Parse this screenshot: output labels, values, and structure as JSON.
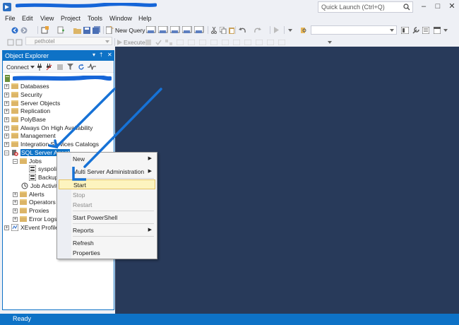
{
  "menubar": {
    "items": [
      "File",
      "Edit",
      "View",
      "Project",
      "Tools",
      "Window",
      "Help"
    ]
  },
  "quick_launch": {
    "placeholder": "Quick Launch (Ctrl+Q)"
  },
  "toolbar": {
    "new_query_label": "New Query",
    "database_value": "pethotel",
    "execute_label": "Execute"
  },
  "object_explorer": {
    "title": "Object Explorer",
    "connect_label": "Connect",
    "nodes": [
      {
        "label": "Databases"
      },
      {
        "label": "Security"
      },
      {
        "label": "Server Objects"
      },
      {
        "label": "Replication"
      },
      {
        "label": "PolyBase"
      },
      {
        "label": "Always On High Availability"
      },
      {
        "label": "Management"
      },
      {
        "label": "Integration Services Catalogs"
      },
      {
        "label": "SQL Server Agent"
      },
      {
        "label": "Jobs"
      },
      {
        "label": "syspoli"
      },
      {
        "label": "Backup"
      },
      {
        "label": "Job Activity"
      },
      {
        "label": "Alerts"
      },
      {
        "label": "Operators"
      },
      {
        "label": "Proxies"
      },
      {
        "label": "Error Logs"
      },
      {
        "label": "XEvent Profiler"
      }
    ]
  },
  "context_menu": {
    "items": [
      {
        "label": "New"
      },
      {
        "label": "Multi Server Administration"
      },
      {
        "label": "Start"
      },
      {
        "label": "Stop"
      },
      {
        "label": "Restart"
      },
      {
        "label": "Start PowerShell"
      },
      {
        "label": "Reports"
      },
      {
        "label": "Refresh"
      },
      {
        "label": "Properties"
      }
    ]
  },
  "status": {
    "text": "Ready"
  },
  "colors": {
    "accent": "#0e72c6",
    "document_bg": "#283a5a",
    "highlight": "#fdf4bf"
  }
}
